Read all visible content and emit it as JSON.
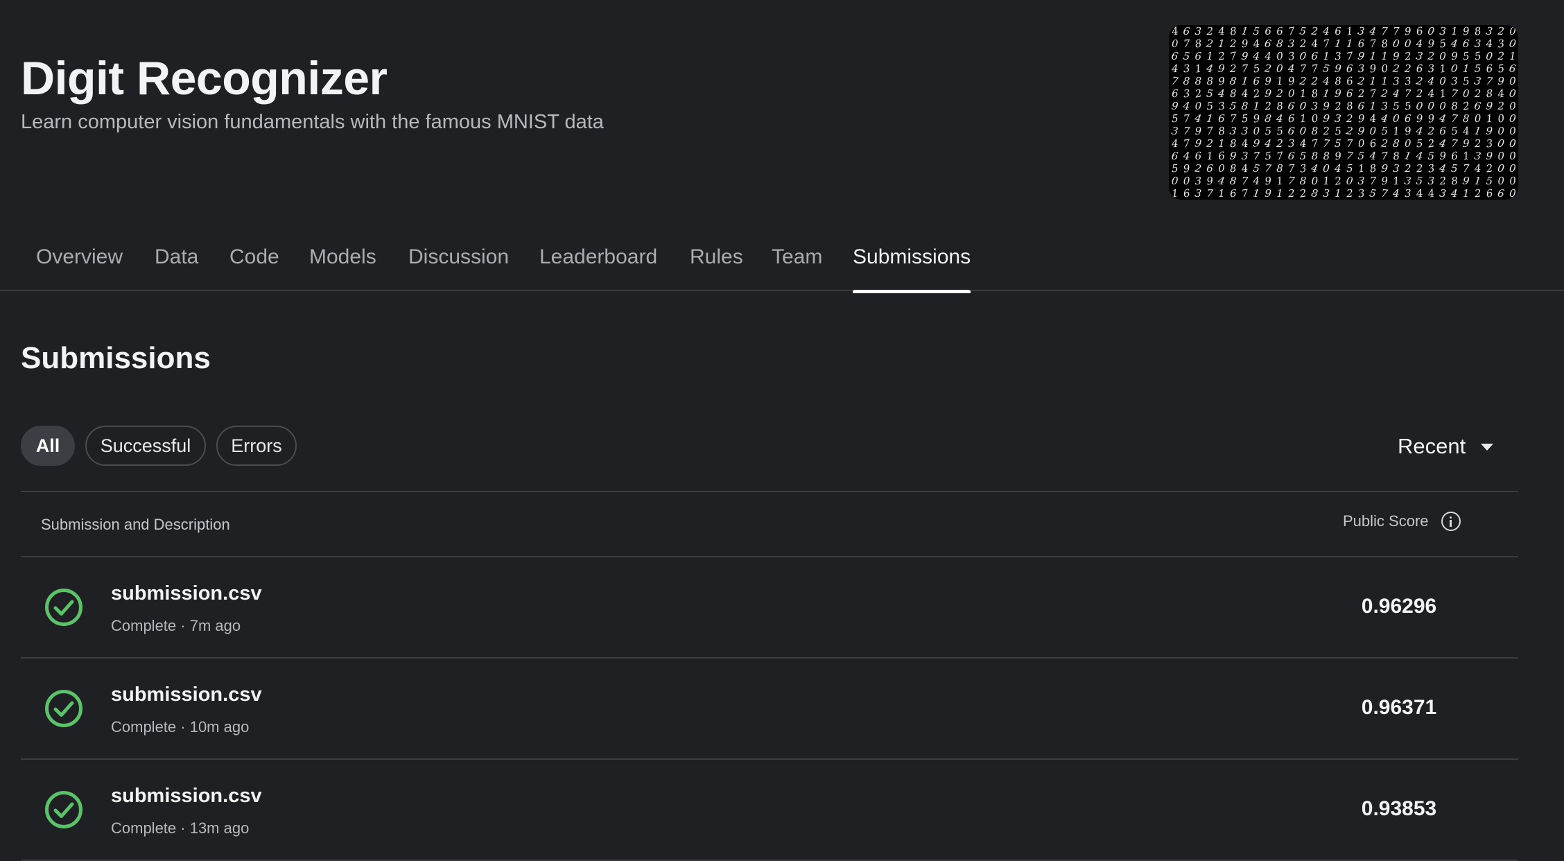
{
  "competition": {
    "title": "Digit Recognizer",
    "subtitle": "Learn computer vision fundamentals with the famous MNIST data",
    "banner_rows": [
      "463248156675246134779603198320",
      "078212946832471167800495463430",
      "656127944030613791192320955021",
      "431492752047759639022631015656",
      "788898169192248621133240353790",
      "632548429201819627247241702840",
      "940535812860392861355000826920",
      "574167598461093294406994780100",
      "379783305560825290519426541900",
      "479218494234775706280524792300",
      "646169375765889754781459613900",
      "592608457873404518932234574200",
      "003948749178012037913532891500",
      "163716719122831235743443412660"
    ]
  },
  "tabs": [
    {
      "label": "Overview"
    },
    {
      "label": "Data"
    },
    {
      "label": "Code"
    },
    {
      "label": "Models"
    },
    {
      "label": "Discussion"
    },
    {
      "label": "Leaderboard"
    },
    {
      "label": "Rules"
    },
    {
      "label": "Team"
    },
    {
      "label": "Submissions",
      "active": true
    }
  ],
  "section_title": "Submissions",
  "filters": {
    "all": "All",
    "successful": "Successful",
    "errors": "Errors",
    "selected": "All"
  },
  "sort": {
    "label": "Recent"
  },
  "table": {
    "col_description": "Submission and Description",
    "col_score": "Public Score",
    "rows": [
      {
        "file": "submission.csv",
        "meta": "Complete · 7m ago",
        "score": "0.96296",
        "status": "success"
      },
      {
        "file": "submission.csv",
        "meta": "Complete · 10m ago",
        "score": "0.96371",
        "status": "success"
      },
      {
        "file": "submission.csv",
        "meta": "Complete · 13m ago",
        "score": "0.93853",
        "status": "success"
      }
    ]
  },
  "colors": {
    "background": "#1f2023",
    "success": "#5cc26a",
    "divider": "#3a3c40"
  }
}
